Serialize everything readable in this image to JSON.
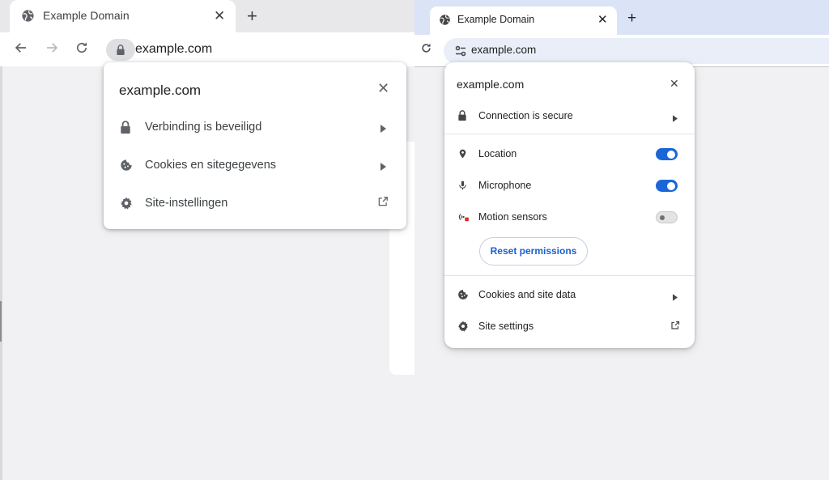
{
  "left_browser": {
    "tab": {
      "title": "Example Domain",
      "icon": "globe-icon",
      "close_icon": "close-icon"
    },
    "new_tab_icon": "plus-icon",
    "toolbar": {
      "back_icon": "arrow-left-icon",
      "forward_icon": "arrow-right-icon",
      "reload_icon": "reload-icon",
      "lock_icon": "lock-icon",
      "url": "example.com"
    },
    "popup": {
      "title": "example.com",
      "close_icon": "close-icon",
      "items": [
        {
          "label": "Verbinding is beveiligd",
          "icon": "lock-icon",
          "trailing": "arrow-right-icon"
        },
        {
          "label": "Cookies en sitegegevens",
          "icon": "cookie-icon",
          "trailing": "arrow-right-icon"
        },
        {
          "label": "Site-instellingen",
          "icon": "gear-icon",
          "trailing": "external-link-icon"
        }
      ]
    }
  },
  "right_browser": {
    "tab": {
      "title": "Example Domain",
      "icon": "globe-icon",
      "close_icon": "close-icon"
    },
    "new_tab_icon": "plus-icon",
    "toolbar": {
      "reload_icon": "reload-icon",
      "tune_icon": "tune-icon",
      "url": "example.com"
    },
    "popup": {
      "title": "example.com",
      "close_icon": "close-icon",
      "connection": {
        "label": "Connection is secure",
        "icon": "lock-icon",
        "trailing": "arrow-right-icon"
      },
      "permissions": [
        {
          "label": "Location",
          "icon": "location-pin-icon",
          "enabled": true
        },
        {
          "label": "Microphone",
          "icon": "microphone-icon",
          "enabled": true
        },
        {
          "label": "Motion sensors",
          "icon": "motion-sensor-blocked-icon",
          "enabled": false
        }
      ],
      "reset_label": "Reset permissions",
      "items": [
        {
          "label": "Cookies and site data",
          "icon": "cookie-icon",
          "trailing": "arrow-right-icon"
        },
        {
          "label": "Site settings",
          "icon": "gear-icon",
          "trailing": "external-link-icon"
        }
      ]
    }
  },
  "colors": {
    "toggle_on": "#1a66d9",
    "reset_text": "#1a5fd0",
    "right_tabstrip": "#dbe3f7"
  }
}
